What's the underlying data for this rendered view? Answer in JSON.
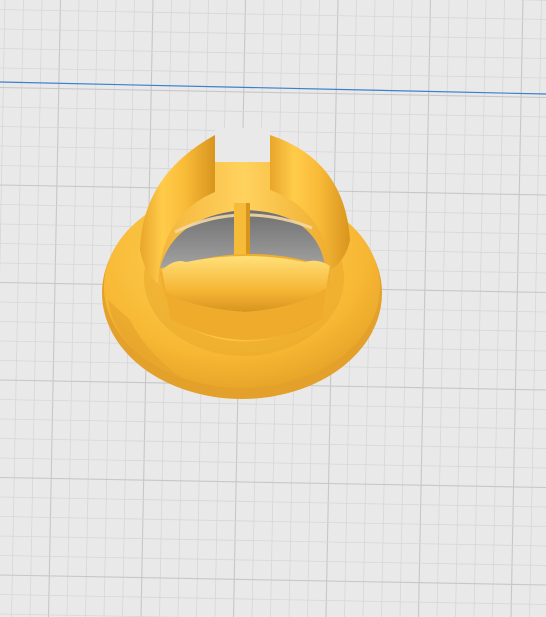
{
  "viewport": {
    "background_color": "#e9e9e9",
    "grid_minor_color": "#d7d7d7",
    "grid_major_color": "#c7c7c7",
    "axis_color": "#3a7fd0",
    "model_color": "#f7b834",
    "model_shadow_color": "#d99a1e",
    "hole_color": "#8f8f8f"
  },
  "model": {
    "type": "bushing-with-flange-and-slotted-tube"
  }
}
